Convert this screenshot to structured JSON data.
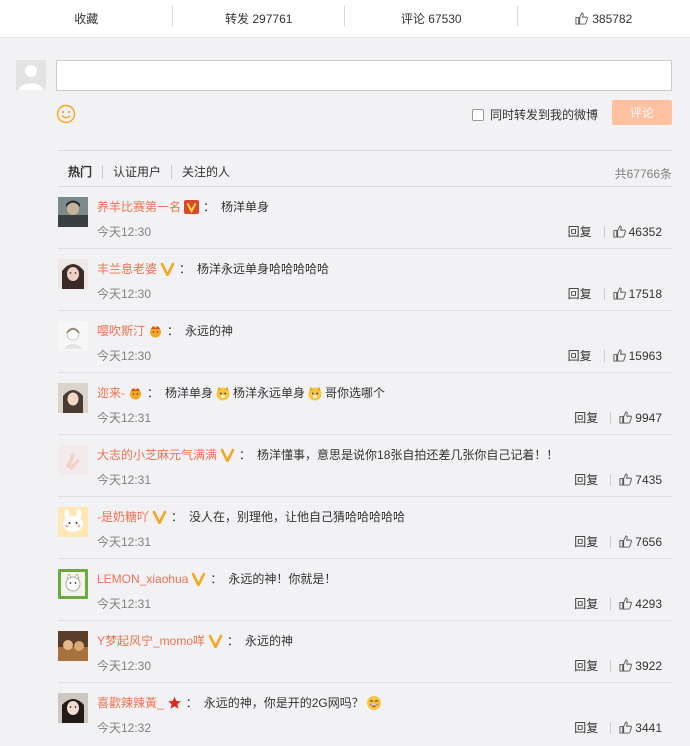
{
  "action_bar": {
    "favorite": "收藏",
    "repost": "转发 297761",
    "comment": "评论 67530",
    "like": "385782"
  },
  "compose": {
    "repost_label": "同时转发到我的微博",
    "submit": "评论"
  },
  "filters": {
    "tabs": [
      "热门",
      "认证用户",
      "关注的人"
    ],
    "total": "共67766条"
  },
  "comments": [
    {
      "user": "养羊比赛第一名",
      "text": "杨洋单身",
      "time": "今天12:30",
      "reply": "回复",
      "likes": "46352"
    },
    {
      "user": "丰兰息老婆",
      "text": "杨洋永远单身哈哈哈哈哈",
      "time": "今天12:30",
      "reply": "回复",
      "likes": "17518"
    },
    {
      "user": "嘤吹斯汀",
      "text": "永远的神",
      "time": "今天12:30",
      "reply": "回复",
      "likes": "15963"
    },
    {
      "user": "迩来-",
      "text_a": "杨洋单身",
      "text_b": "杨洋永远单身",
      "text_c": "哥你选哪个",
      "time": "今天12:31",
      "reply": "回复",
      "likes": "9947"
    },
    {
      "user": "大志的小芝麻元气满满",
      "text": "杨洋懂事，意思是说你18张自拍还差几张你自己记着！！",
      "time": "今天12:31",
      "reply": "回复",
      "likes": "7435"
    },
    {
      "user": "-是奶糖吖",
      "text": "没人在，别理他，让他自己猜哈哈哈哈哈",
      "time": "今天12:31",
      "reply": "回复",
      "likes": "7656"
    },
    {
      "user": "LEMON_xiaohua",
      "text": "永远的神！你就是！",
      "time": "今天12:31",
      "reply": "回复",
      "likes": "4293"
    },
    {
      "user": "Y梦起风宁_momo咩",
      "text": "永远的神",
      "time": "今天12:30",
      "reply": "回复",
      "likes": "3922"
    },
    {
      "user": "喜歡辣辣黃_",
      "text": "永远的神，你是开的2G网吗？",
      "time": "今天12:32",
      "reply": "回复",
      "likes": "3441"
    }
  ],
  "colors": {
    "username": "#eb7350",
    "submit_button": "#ffc09f",
    "badge_gold": "#f5a623",
    "badge_red": "#d94a2a"
  }
}
